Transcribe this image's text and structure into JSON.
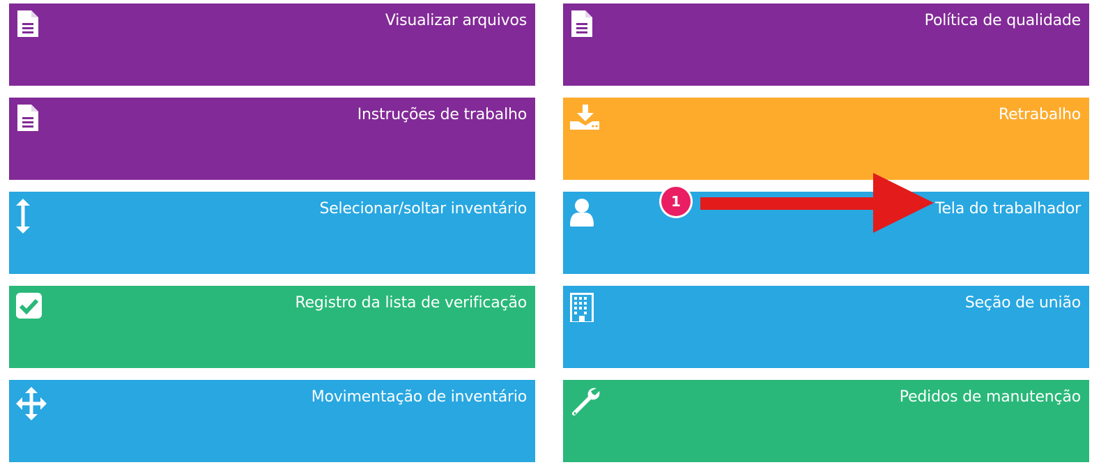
{
  "colors": {
    "purple": "#822a97",
    "orange": "#feab2c",
    "blue": "#28a7e1",
    "green": "#29b879",
    "annotation_red": "#e31b1b",
    "badge_pink": "#e91e63"
  },
  "tiles": [
    {
      "label": "Visualizar arquivos",
      "icon": "document-icon",
      "color": "purple"
    },
    {
      "label": "Política de qualidade",
      "icon": "document-icon",
      "color": "purple"
    },
    {
      "label": "Instruções de trabalho",
      "icon": "document-icon",
      "color": "purple"
    },
    {
      "label": "Retrabalho",
      "icon": "download-tray-icon",
      "color": "orange"
    },
    {
      "label": "Selecionar/soltar inventário",
      "icon": "vertical-arrows-icon",
      "color": "blue"
    },
    {
      "label": "Tela do trabalhador",
      "icon": "user-icon",
      "color": "blue"
    },
    {
      "label": "Registro da lista de verificação",
      "icon": "checkbox-icon",
      "color": "green"
    },
    {
      "label": "Seção de união",
      "icon": "building-icon",
      "color": "blue"
    },
    {
      "label": "Movimentação de inventário",
      "icon": "move-arrows-icon",
      "color": "blue"
    },
    {
      "label": "Pedidos de manutenção",
      "icon": "wrench-icon",
      "color": "green"
    }
  ],
  "annotation": {
    "badge_number": "1"
  }
}
